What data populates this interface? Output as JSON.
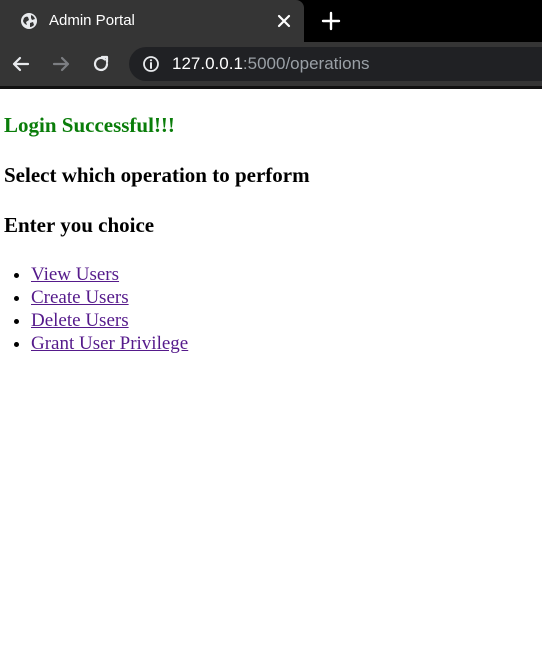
{
  "browser": {
    "tab_title": "Admin Portal",
    "url_host": "127.0.0.1",
    "url_path": ":5000/operations"
  },
  "page": {
    "success_message": "Login Successful!!!",
    "prompt_heading": "Select which operation to perform",
    "choice_heading": "Enter you choice",
    "operations": [
      {
        "label": "View Users"
      },
      {
        "label": "Create Users"
      },
      {
        "label": "Delete Users"
      },
      {
        "label": "Grant User Privilege"
      }
    ]
  },
  "colors": {
    "success": "#0a7d0a",
    "visited_link": "#551a8b",
    "chrome_dark": "#202124",
    "chrome_toolbar": "#353535"
  },
  "icons": {
    "favicon": "globe-icon",
    "tab_close": "close-icon",
    "new_tab": "plus-icon",
    "back": "arrow-left-icon",
    "forward": "arrow-right-icon",
    "reload": "reload-icon",
    "site_info": "info-icon"
  }
}
